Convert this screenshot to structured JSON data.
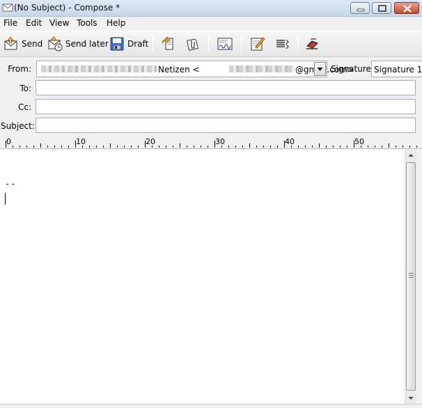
{
  "window": {
    "title": "(No Subject) - Compose *",
    "icon": "mail-compose-icon"
  },
  "menu": [
    "File",
    "Edit",
    "View",
    "Tools",
    "Help"
  ],
  "toolbar": {
    "send_label": "Send",
    "send_later_label": "Send later",
    "draft_label": "Draft",
    "icons": [
      "send-icon",
      "send-later-icon",
      "draft-icon",
      "insert-file-icon",
      "attach-icon",
      "signature-icon",
      "edit-icon",
      "format-icon",
      "spellcheck-icon"
    ]
  },
  "headers": {
    "from_label": "From:",
    "from_name": "Netizen <",
    "from_domain": "@gmail.com>",
    "signature_label": "Signature:",
    "signature_value": "Signature 1",
    "to_label": "To:",
    "to_value": "",
    "cc_label": "Cc:",
    "cc_value": "",
    "subject_label": "Subject:",
    "subject_value": ""
  },
  "ruler": {
    "labels": [
      "0",
      "10",
      "20",
      "30",
      "40",
      "50"
    ]
  },
  "body": {
    "signature_separator": "--"
  }
}
